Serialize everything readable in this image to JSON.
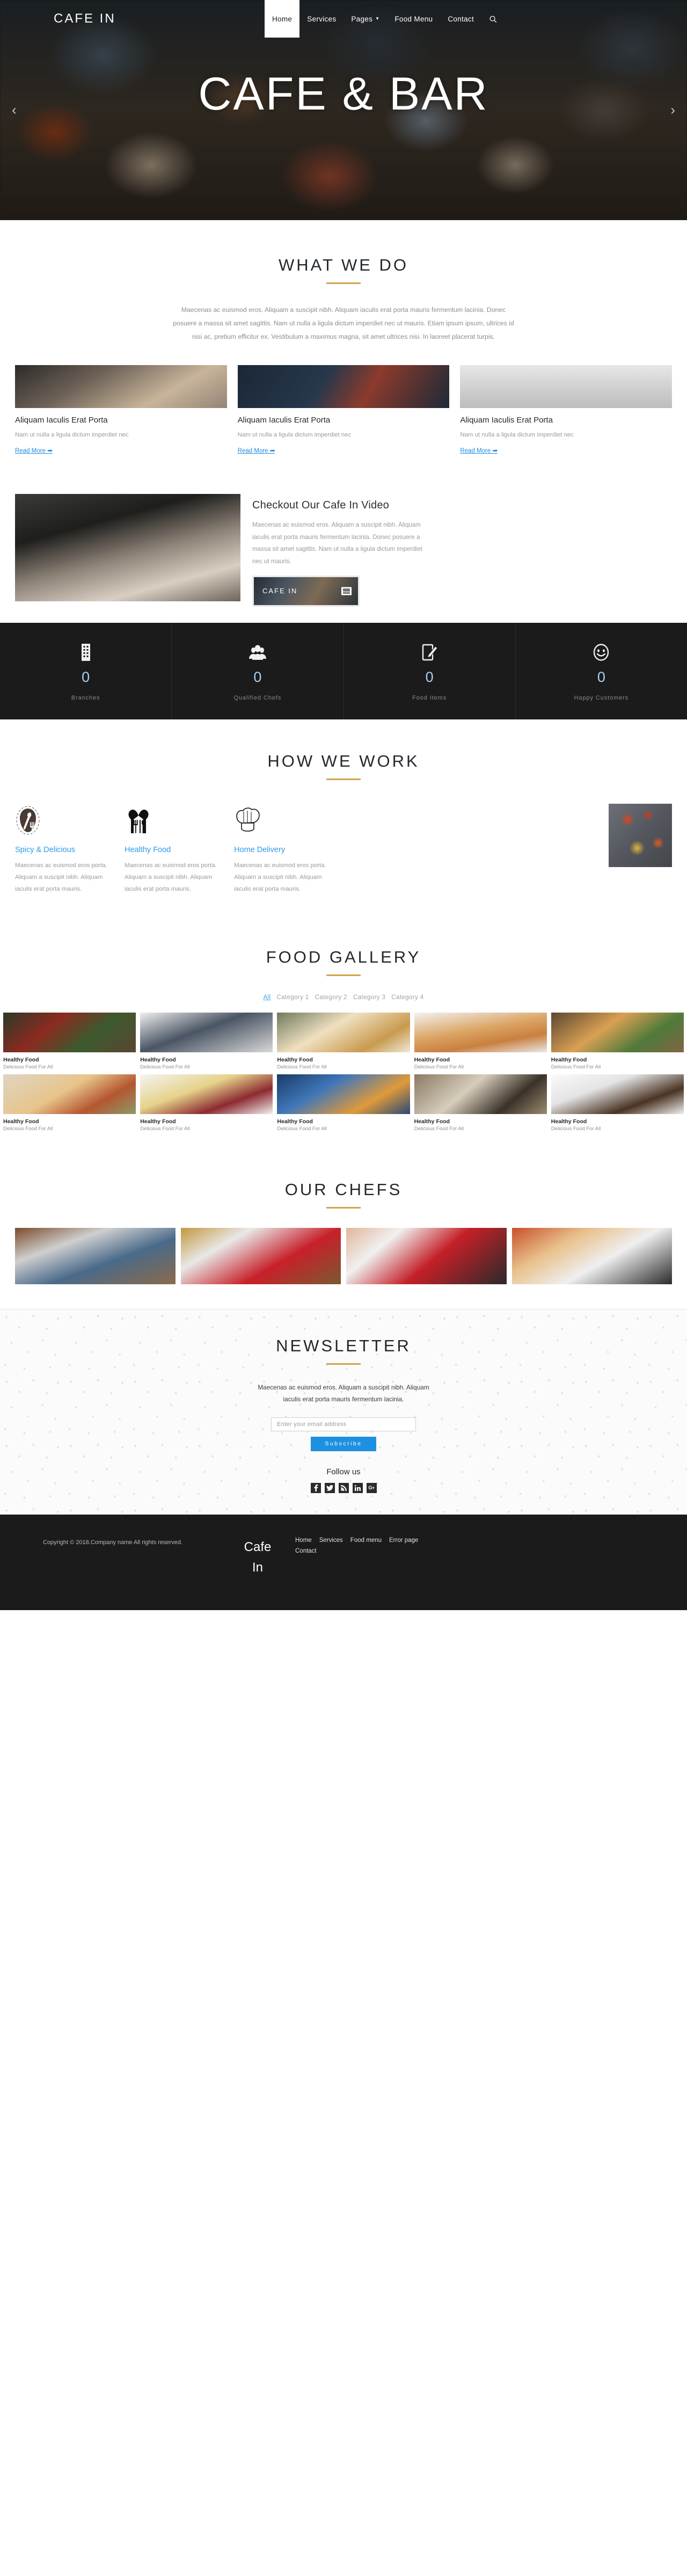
{
  "header": {
    "brand": "CAFE IN",
    "nav": [
      {
        "label": "Home",
        "active": true
      },
      {
        "label": "Services",
        "active": false
      },
      {
        "label": "Pages",
        "active": false,
        "caret": true
      },
      {
        "label": "Food Menu",
        "active": false
      },
      {
        "label": "Contact",
        "active": false
      }
    ],
    "search_icon": "search-icon"
  },
  "hero": {
    "title": "CAFE & BAR",
    "prev": "‹",
    "next": "›"
  },
  "what_we_do": {
    "title": "WHAT WE DO",
    "paragraph": "Maecenas ac euismod eros. Aliquam a suscipit nibh. Aliquam iaculis erat porta mauris fermentum lacinia. Donec posuere a massa sit amet sagittis. Nam ut nulla a ligula dictum imperdiet nec ut mauris. Etiam ipsum ipsum, ultrices id nisi ac, pretium efficitur ex. Vestibulum a maximus magna, sit amet ultrices nisi. In laoreet placerat turpis.",
    "cards": [
      {
        "title": "Aliquam Iaculis Erat Porta",
        "text": "Nam ut nulla a ligula dictum imperdiet nec",
        "link": "Read More ➡"
      },
      {
        "title": "Aliquam Iaculis Erat Porta",
        "text": "Nam ut nulla a ligula dictum imperdiet nec",
        "link": "Read More ➡"
      },
      {
        "title": "Aliquam Iaculis Erat Porta",
        "text": "Nam ut nulla a ligula dictum imperdiet nec",
        "link": "Read More ➡"
      }
    ]
  },
  "video": {
    "heading": "Checkout Our Cafe In Video",
    "paragraph": "Maecenas ac euismod eros. Aliquam a suscipit nibh. Aliquam iaculis erat porta mauris fermentum lacinia. Donec posuere a massa sit amet sagittis. Nam ut nulla a ligula dictum imperdiet nec ut mauris.",
    "thumb_label": "CAFE IN"
  },
  "counters": [
    {
      "icon": "building-icon",
      "value": "0",
      "label": "Branches"
    },
    {
      "icon": "users-icon",
      "value": "0",
      "label": "Qualified Chefs"
    },
    {
      "icon": "note-pencil-icon",
      "value": "0",
      "label": "Food Items"
    },
    {
      "icon": "smiley-face-icon",
      "value": "0",
      "label": "Happy Customers"
    }
  ],
  "how_we_work": {
    "title": "HOW WE WORK",
    "items": [
      {
        "icon": "spoon-fork-badge-icon",
        "title": "Spicy & Delicious",
        "text": "Maecenas ac euismod eros porta. Aliquam a suscipit nibh. Aliquam iaculis erat porta mauris."
      },
      {
        "icon": "cutlery-heart-icon",
        "title": "Healthy Food",
        "text": "Maecenas ac euismod eros porta. Aliquam a suscipit nibh. Aliquam iaculis erat porta mauris."
      },
      {
        "icon": "chef-hat-icon",
        "title": "Home Delivery",
        "text": "Maecenas ac euismod eros porta. Aliquam a suscipit nibh. Aliquam iaculis erat porta mauris."
      }
    ]
  },
  "food_gallery": {
    "title": "FOOD GALLERY",
    "filters": [
      {
        "label": "All",
        "active": true
      },
      {
        "label": "Category 1",
        "active": false
      },
      {
        "label": "Category 2",
        "active": false
      },
      {
        "label": "Category 3",
        "active": false
      },
      {
        "label": "Category 4",
        "active": false
      }
    ],
    "items": [
      {
        "title": "Healthy Food",
        "sub": "Delicious Food For All"
      },
      {
        "title": "Healthy Food",
        "sub": "Delicious Food For All"
      },
      {
        "title": "Healthy Food",
        "sub": "Delicious Food For All"
      },
      {
        "title": "Healthy Food",
        "sub": "Delicious Food For All"
      },
      {
        "title": "Healthy Food",
        "sub": "Delicious Food For All"
      },
      {
        "title": "Healthy Food",
        "sub": "Delicious Food For All"
      },
      {
        "title": "Healthy Food",
        "sub": "Delicious Food For All"
      },
      {
        "title": "Healthy Food",
        "sub": "Delicious Food For All"
      },
      {
        "title": "Healthy Food",
        "sub": "Delicious Food For All"
      },
      {
        "title": "Healthy Food",
        "sub": "Delicious Food For All"
      }
    ]
  },
  "our_chefs": {
    "title": "OUR CHEFS"
  },
  "newsletter": {
    "title": "NEWSLETTER",
    "text": "Maecenas ac euismod eros. Aliquam a suscipit nibh. Aliquam iaculis erat porta mauris fermentum lacinia.",
    "placeholder": "Enter your email address",
    "button": "Subscribe",
    "follow_label": "Follow us",
    "socials": [
      {
        "icon": "facebook-icon",
        "glyph": "f"
      },
      {
        "icon": "twitter-icon",
        "glyph": "ᴠ"
      },
      {
        "icon": "rss-icon",
        "glyph": "◠"
      },
      {
        "icon": "linkedin-icon",
        "glyph": "in"
      },
      {
        "icon": "google-plus-icon",
        "glyph": "G+"
      }
    ]
  },
  "footer": {
    "copyright": "Copyright © 2018.Company name All rights reserved.",
    "logo_line1": "Cafe",
    "logo_line2": "In",
    "links": [
      "Home",
      "Services",
      "Food menu",
      "Error page",
      "Contact"
    ]
  },
  "colors": {
    "accent_gold": "#d4a449",
    "accent_blue": "#2e9ae6",
    "link_blue": "#1f8ae0",
    "dark": "#1b1b1b",
    "counter_number": "#a9d0f0"
  }
}
